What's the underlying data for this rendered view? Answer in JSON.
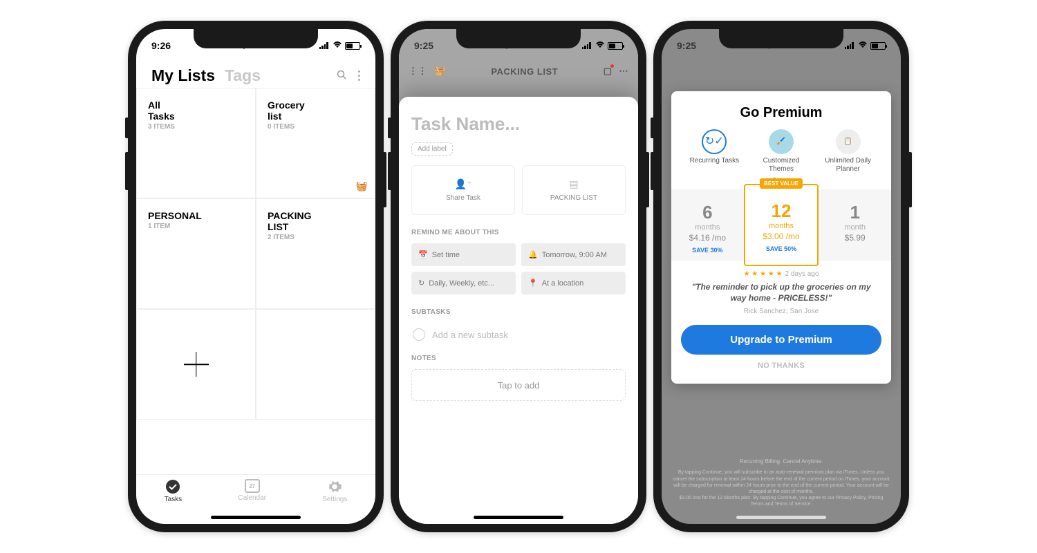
{
  "phone1": {
    "status_time": "9:26",
    "tabs": {
      "active": "My Lists",
      "inactive": "Tags"
    },
    "lists": [
      {
        "title": "All Tasks",
        "sub": "3 ITEMS"
      },
      {
        "title": "Grocery list",
        "sub": "0 ITEMS",
        "icon": "basket"
      },
      {
        "title": "PERSONAL",
        "sub": "1 ITEM"
      },
      {
        "title": "PACKING LIST",
        "sub": "2 ITEMS"
      }
    ],
    "tabbar": {
      "tasks": "Tasks",
      "calendar": "Calendar",
      "calendar_num": "27",
      "settings": "Settings"
    }
  },
  "phone2": {
    "status_time": "9:25",
    "header_title": "PACKING LIST",
    "task_name_placeholder": "Task Name...",
    "add_label": "Add label",
    "share_task": "Share Task",
    "list_card": "PACKING LIST",
    "remind_header": "REMIND ME ABOUT THIS",
    "chips": {
      "set_time": "Set time",
      "tomorrow": "Tomorrow, 9:00 AM",
      "repeat": "Daily, Weekly, etc...",
      "location": "At a location"
    },
    "subtasks_header": "SUBTASKS",
    "subtask_placeholder": "Add a new subtask",
    "notes_header": "NOTES",
    "notes_placeholder": "Tap to add"
  },
  "phone3": {
    "status_time": "9:25",
    "title": "Go Premium",
    "features": [
      {
        "label": "Recurring Tasks"
      },
      {
        "label": "Customized Themes"
      },
      {
        "label": "Unlimited Daily Planner"
      }
    ],
    "plans": [
      {
        "num": "6",
        "unit": "months",
        "price": "$4.16 /mo",
        "save": "SAVE 30%"
      },
      {
        "num": "12",
        "unit": "months",
        "price": "$3.00 /mo",
        "save": "SAVE 50%",
        "badge": "BEST VALUE"
      },
      {
        "num": "1",
        "unit": "month",
        "price": "$5.99"
      }
    ],
    "rating_age": "2 days ago",
    "quote": "\"The reminder to pick up the groceries on my way home - PRICELESS!\"",
    "author": "Rick Sanchez, San Jose",
    "cta": "Upgrade to Premium",
    "no_thanks": "NO THANKS",
    "fine_head": "Recurring Billing. Cancel Anytime.",
    "fine_body": "By tapping Continue, you will subscribe to an auto-renewal premium plan via iTunes. Unless you cancel the subscription at least 24-hours before the end of the current period on iTunes, your account will be charged for renewal within 24 hours prior to the end of the current period. Your account will be charged at the cost of months.",
    "fine_body2": "$3.00 /mo for the 12 Months plan. By tapping Continue, you agree to our Privacy Policy, Pricing Terms and Terms of Service."
  }
}
